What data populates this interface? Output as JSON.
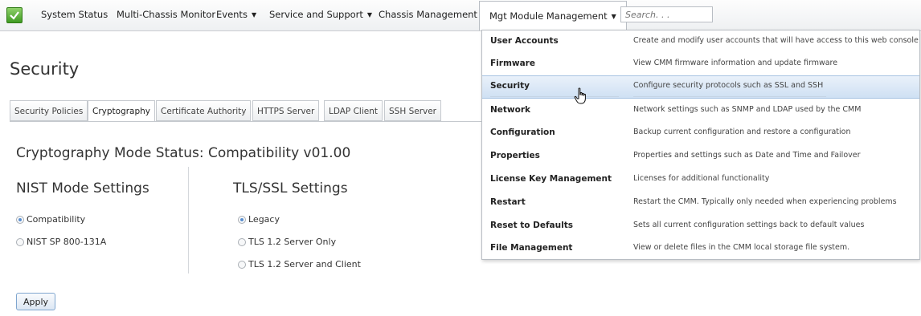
{
  "nav": {
    "items": [
      {
        "label": "System Status",
        "has_caret": false
      },
      {
        "label": "Multi-Chassis Monitor",
        "has_caret": false
      },
      {
        "label": "Events",
        "has_caret": true
      },
      {
        "label": "Service and Support",
        "has_caret": true
      },
      {
        "label": "Chassis Management",
        "has_caret": true
      },
      {
        "label": "Mgt Module Management",
        "has_caret": true,
        "active": true
      }
    ],
    "search_placeholder": "Search. . ."
  },
  "page": {
    "title": "Security",
    "tabs": [
      "Security Policies",
      "Cryptography",
      "Certificate Authority",
      "HTTPS Server",
      "LDAP Client",
      "SSH Server"
    ],
    "active_tab": "Cryptography",
    "status_heading": "Cryptography Mode Status: Compatibility v01.00",
    "nist": {
      "heading": "NIST Mode Settings",
      "options": [
        {
          "label": "Compatibility",
          "checked": true
        },
        {
          "label": "NIST SP 800-131A",
          "checked": false
        }
      ]
    },
    "tls": {
      "heading": "TLS/SSL Settings",
      "options": [
        {
          "label": "Legacy",
          "checked": true
        },
        {
          "label": "TLS 1.2 Server Only",
          "checked": false
        },
        {
          "label": "TLS 1.2 Server and Client",
          "checked": false
        }
      ]
    },
    "apply_label": "Apply"
  },
  "menu": {
    "items": [
      {
        "label": "User Accounts",
        "desc": "Create and modify user accounts that will have access to this web console"
      },
      {
        "label": "Firmware",
        "desc": "View CMM firmware information and update firmware"
      },
      {
        "label": "Security",
        "desc": "Configure security protocols such as SSL and SSH",
        "highlight": true
      },
      {
        "label": "Network",
        "desc": "Network settings such as SNMP and LDAP used by the CMM"
      },
      {
        "label": "Configuration",
        "desc": "Backup current configuration and restore a configuration"
      },
      {
        "label": "Properties",
        "desc": "Properties and settings such as Date and Time and Failover"
      },
      {
        "label": "License Key Management",
        "desc": "Licenses for additional functionality"
      },
      {
        "label": "Restart",
        "desc": "Restart the CMM. Typically only needed when experiencing problems"
      },
      {
        "label": "Reset to Defaults",
        "desc": "Sets all current configuration settings back to default values"
      },
      {
        "label": "File Management",
        "desc": "View or delete files in the CMM local storage file system."
      }
    ]
  },
  "colors": {
    "accent": "#5a8fd0",
    "logo_green": "#3f9a22",
    "menu_highlight": "#cfe0f3"
  }
}
